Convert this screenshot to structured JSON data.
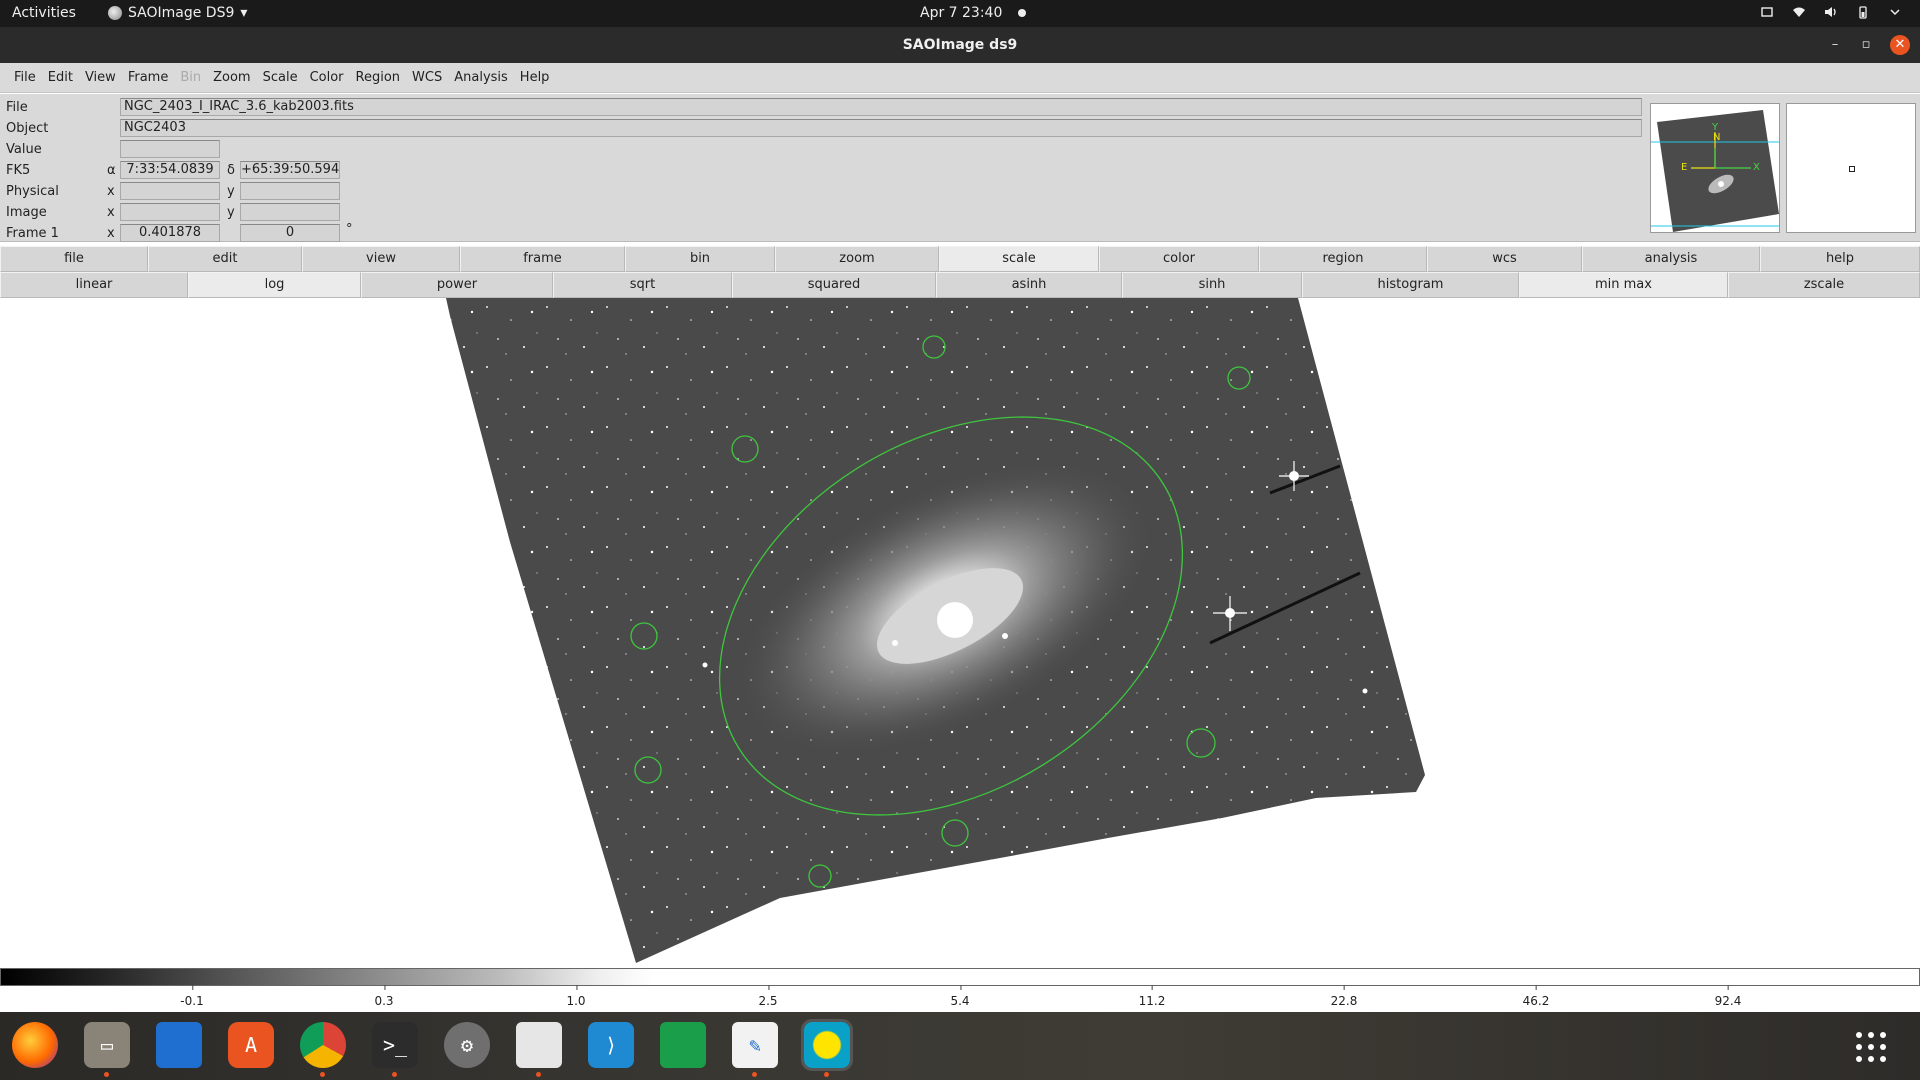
{
  "topbar": {
    "activities": "Activities",
    "app_name": "SAOImage DS9",
    "clock": "Apr 7  23:40"
  },
  "window": {
    "title": "SAOImage ds9"
  },
  "menubar": [
    "File",
    "Edit",
    "View",
    "Frame",
    "Bin",
    "Zoom",
    "Scale",
    "Color",
    "Region",
    "WCS",
    "Analysis",
    "Help"
  ],
  "info": {
    "file_label": "File",
    "file_value": "NGC_2403_I_IRAC_3.6_kab2003.fits",
    "object_label": "Object",
    "object_value": "NGC2403",
    "value_label": "Value",
    "value_value": "",
    "fk5_label": "FK5",
    "fk5_alpha_sym": "α",
    "fk5_alpha": "7:33:54.0839",
    "fk5_delta_sym": "δ",
    "fk5_delta": "+65:39:50.594",
    "physical_label": "Physical",
    "physical_x_sym": "x",
    "physical_y_sym": "y",
    "physical_x": "",
    "physical_y": "",
    "image_label": "Image",
    "image_x_sym": "x",
    "image_y_sym": "y",
    "image_x": "",
    "image_y": "",
    "frame_label": "Frame 1",
    "frame_x_sym": "x",
    "frame_zoom": "0.401878",
    "frame_angle": "0",
    "frame_angle_unit": "°"
  },
  "panner": {
    "north": "N",
    "east": "E",
    "x_axis": "X",
    "y_axis": "Y"
  },
  "buttonbar_main": [
    "file",
    "edit",
    "view",
    "frame",
    "bin",
    "zoom",
    "scale",
    "color",
    "region",
    "wcs",
    "analysis",
    "help"
  ],
  "buttonbar_main_active": "scale",
  "buttonbar_scale": [
    "linear",
    "log",
    "power",
    "sqrt",
    "squared",
    "asinh",
    "sinh",
    "histogram",
    "min max",
    "zscale"
  ],
  "buttonbar_scale_active": [
    "log",
    "min max"
  ],
  "colorbar_ticks": [
    "-0.1",
    "0.3",
    "1.0",
    "2.5",
    "5.4",
    "11.2",
    "22.8",
    "46.2",
    "92.4"
  ],
  "dock": [
    {
      "name": "firefox",
      "running": false
    },
    {
      "name": "files",
      "running": true
    },
    {
      "name": "libreoffice-writer",
      "running": false
    },
    {
      "name": "ubuntu-software",
      "running": false
    },
    {
      "name": "chrome",
      "running": true
    },
    {
      "name": "terminal",
      "running": true
    },
    {
      "name": "settings",
      "running": false
    },
    {
      "name": "document-viewer",
      "running": true
    },
    {
      "name": "vscode",
      "running": false
    },
    {
      "name": "libreoffice-calc",
      "running": false
    },
    {
      "name": "text-editor",
      "running": true
    },
    {
      "name": "ds9",
      "running": true
    }
  ],
  "colors": {
    "region": "#3ec63e",
    "accent": "#e95420"
  }
}
